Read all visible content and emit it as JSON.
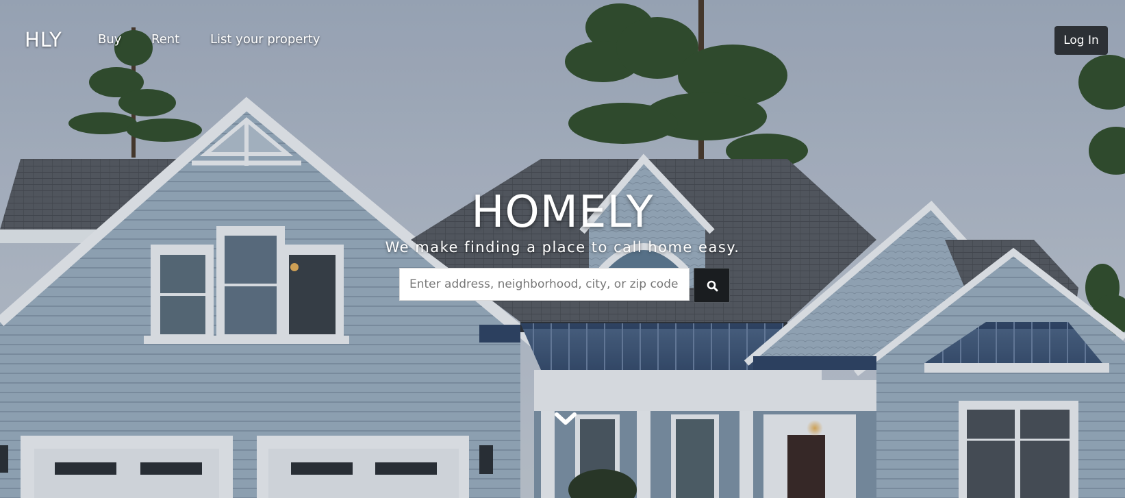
{
  "nav": {
    "brand": "HLY",
    "links": [
      "Buy",
      "Rent",
      "List your property"
    ],
    "login_label": "Log In"
  },
  "hero": {
    "title": "HOMELY",
    "subtitle": "We make finding a place to call home easy.",
    "search_placeholder": "Enter address, neighborhood, city, or zip code",
    "search_icon": "search-icon",
    "scroll_icon": "chevron-down-icon"
  },
  "colors": {
    "login_bg": "#2c3035",
    "search_button_bg": "#1a1d20",
    "text": "#ffffff"
  }
}
